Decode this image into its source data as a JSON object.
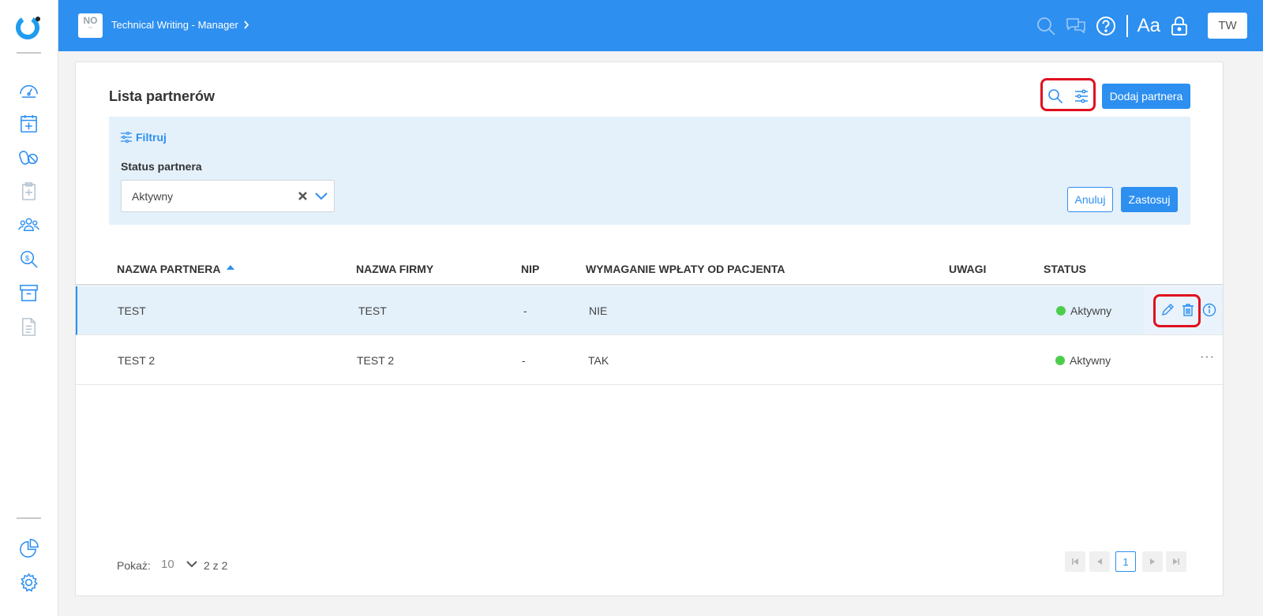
{
  "app": {
    "brand_color": "#2d8ff0",
    "highlight_color": "#e0101f"
  },
  "sidebar": {
    "logo": "app-logo-icon",
    "items": [
      {
        "icon": "dashboard-icon"
      },
      {
        "icon": "calendar-add-icon"
      },
      {
        "icon": "pills-icon"
      },
      {
        "icon": "clipboard-medical-icon"
      },
      {
        "icon": "users-group-icon"
      },
      {
        "icon": "search-money-icon"
      },
      {
        "icon": "archive-icon"
      },
      {
        "icon": "document-icon"
      }
    ],
    "bottom_items": [
      {
        "icon": "pie-chart-icon"
      },
      {
        "icon": "gear-icon"
      }
    ]
  },
  "topbar": {
    "workspace_logo_text": "NO",
    "breadcrumb": "Technical Writing - Manager",
    "font_toggle": "Aa",
    "avatar_initials": "TW"
  },
  "page": {
    "title": "Lista partnerów",
    "add_button": "Dodaj partnera"
  },
  "filter": {
    "title": "Filtruj",
    "status_label": "Status partnera",
    "status_value": "Aktywny",
    "cancel_button": "Anuluj",
    "apply_button": "Zastosuj"
  },
  "table": {
    "columns": [
      "NAZWA PARTNERA",
      "NAZWA FIRMY",
      "NIP",
      "WYMAGANIE WPŁATY OD PACJENTA",
      "UWAGI",
      "STATUS"
    ],
    "sort_column": "NAZWA PARTNERA",
    "sort_direction": "ascending",
    "rows": [
      {
        "partner": "TEST",
        "company": "TEST",
        "nip": "-",
        "payment": "NIE",
        "notes": "",
        "status": "Aktywny",
        "status_color": "#4cce4c",
        "selected": true
      },
      {
        "partner": "TEST 2",
        "company": "TEST 2",
        "nip": "-",
        "payment": "TAK",
        "notes": "",
        "status": "Aktywny",
        "status_color": "#4cce4c",
        "selected": false
      }
    ]
  },
  "footer": {
    "show_label": "Pokaż:",
    "page_size": "10",
    "count": "2 z 2",
    "current_page": "1"
  }
}
